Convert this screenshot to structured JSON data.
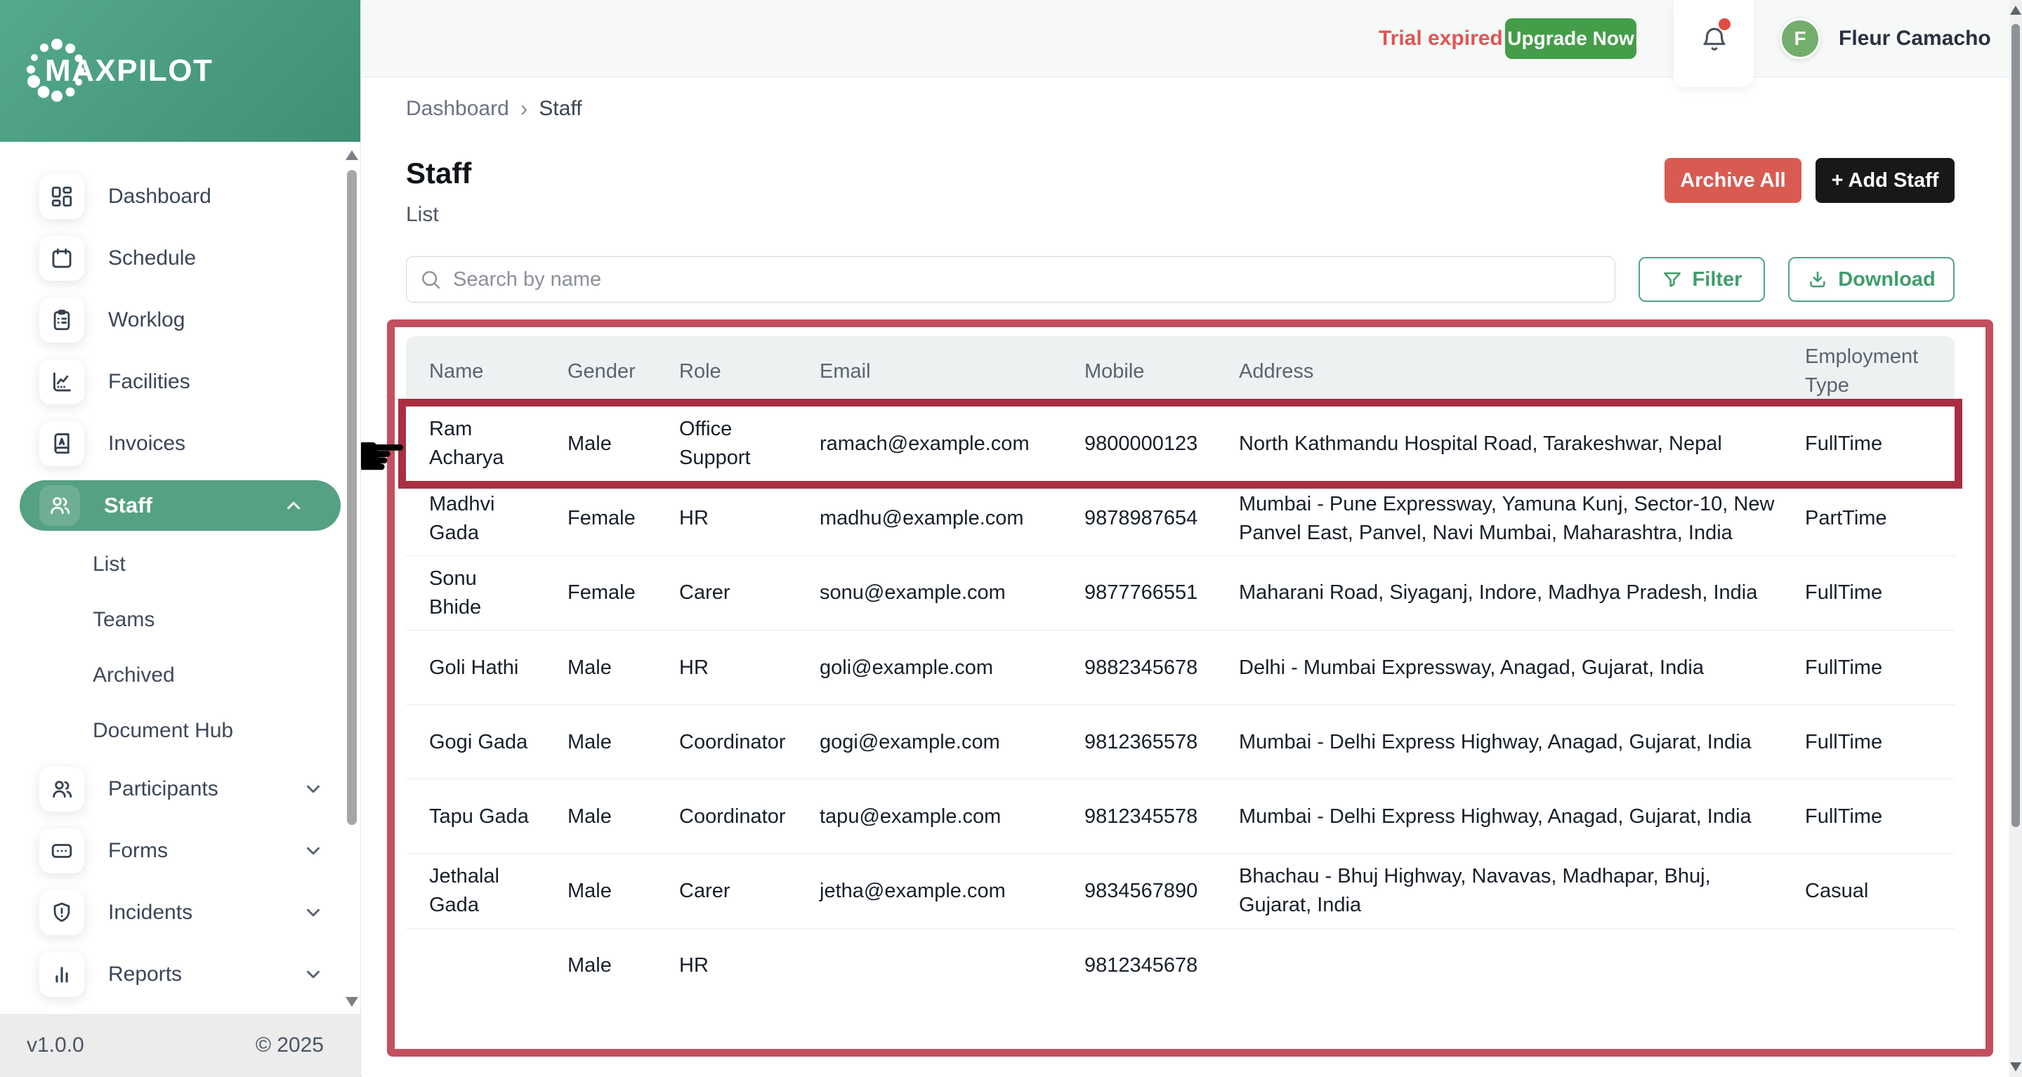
{
  "colors": {
    "brand_green": "#55a183",
    "logo_gradient_start": "#55a98c",
    "logo_gradient_end": "#3f8f74",
    "upgrade_green": "#449d48",
    "danger_red": "#d95a50",
    "trial_red": "#e05555",
    "annotation_outer_red": "#c44f5e",
    "annotation_inner_red": "#a92e42",
    "avatar_green": "#72ae6c",
    "add_staff_black": "#17181a",
    "outline_button_green": "#3f9d6d",
    "table_header_bg": "#edf1f1"
  },
  "sidebar": {
    "logo": "MAXPILOT",
    "items": [
      {
        "label": "Dashboard"
      },
      {
        "label": "Schedule"
      },
      {
        "label": "Worklog"
      },
      {
        "label": "Facilities"
      },
      {
        "label": "Invoices"
      },
      {
        "label": "Staff",
        "active": true,
        "expanded": true
      },
      {
        "label": "Participants"
      },
      {
        "label": "Forms"
      },
      {
        "label": "Incidents"
      },
      {
        "label": "Reports"
      }
    ],
    "staff_submenu": [
      "List",
      "Teams",
      "Archived",
      "Document Hub"
    ],
    "footer": {
      "version": "v1.0.0",
      "copyright": "© 2025"
    }
  },
  "topbar": {
    "trial": "Trial expired",
    "upgrade": "Upgrade Now",
    "user": {
      "initial": "F",
      "name": "Fleur Camacho"
    }
  },
  "breadcrumb": {
    "parent": "Dashboard",
    "separator": "›",
    "current": "Staff"
  },
  "page": {
    "title": "Staff",
    "subtitle": "List"
  },
  "actions": {
    "archive_all": "Archive All",
    "add_staff": "+ Add Staff",
    "filter": "Filter",
    "download": "Download"
  },
  "search": {
    "placeholder": "Search by name"
  },
  "annotation": {
    "hand_glyph": "☛"
  },
  "table": {
    "headers": [
      "Name",
      "Gender",
      "Role",
      "Email",
      "Mobile",
      "Address",
      "Employment Type"
    ],
    "rows": [
      {
        "name": "Ram Acharya",
        "gender": "Male",
        "role": "Office Support",
        "email": "ramach@example.com",
        "mobile": "9800000123",
        "address": "North Kathmandu Hospital Road, Tarakeshwar, Nepal",
        "employment": "FullTime"
      },
      {
        "name": "Madhvi Gada",
        "gender": "Female",
        "role": "HR",
        "email": "madhu@example.com",
        "mobile": "9878987654",
        "address": "Mumbai - Pune Expressway, Yamuna Kunj, Sector-10, New Panvel East, Panvel, Navi Mumbai, Maharashtra, India",
        "employment": "PartTime"
      },
      {
        "name": "Sonu Bhide",
        "gender": "Female",
        "role": "Carer",
        "email": "sonu@example.com",
        "mobile": "9877766551",
        "address": "Maharani Road, Siyaganj, Indore, Madhya Pradesh, India",
        "employment": "FullTime"
      },
      {
        "name": "Goli Hathi",
        "gender": "Male",
        "role": "HR",
        "email": "goli@example.com",
        "mobile": "9882345678",
        "address": "Delhi - Mumbai Expressway, Anagad, Gujarat, India",
        "employment": "FullTime"
      },
      {
        "name": "Gogi Gada",
        "gender": "Male",
        "role": "Coordinator",
        "email": "gogi@example.com",
        "mobile": "9812365578",
        "address": "Mumbai - Delhi Express Highway, Anagad, Gujarat, India",
        "employment": "FullTime"
      },
      {
        "name": "Tapu Gada",
        "gender": "Male",
        "role": "Coordinator",
        "email": "tapu@example.com",
        "mobile": "9812345578",
        "address": "Mumbai - Delhi Express Highway, Anagad, Gujarat, India",
        "employment": "FullTime"
      },
      {
        "name": "Jethalal Gada",
        "gender": "Male",
        "role": "Carer",
        "email": "jetha@example.com",
        "mobile": "9834567890",
        "address": "Bhachau - Bhuj Highway, Navavas, Madhapar, Bhuj, Gujarat, India",
        "employment": "Casual"
      }
    ],
    "partial_row": {
      "name": "",
      "gender": "Male",
      "role": "HR",
      "email": "",
      "mobile": "9812345678",
      "address": "",
      "employment": ""
    }
  }
}
